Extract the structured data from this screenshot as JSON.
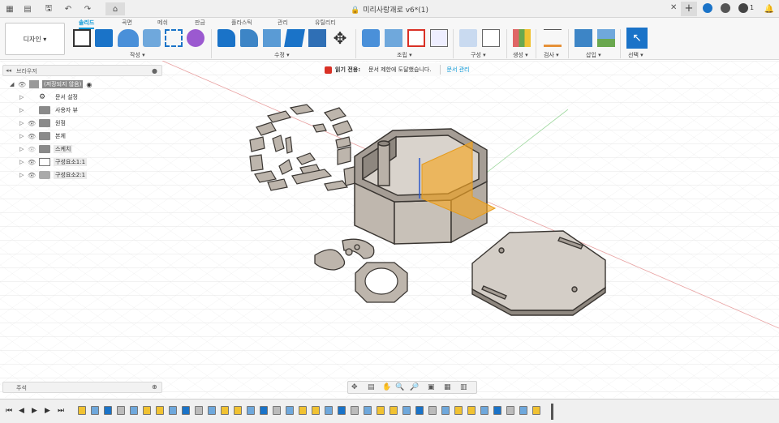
{
  "titlebar": {
    "title": "미리사랑괘로 v6*(1)",
    "notification_count": "1"
  },
  "ribbon": {
    "workspace": "디자인 ▾",
    "tabs": [
      "솔리드",
      "곡면",
      "메쉬",
      "판금",
      "플라스틱",
      "관리",
      "유틸리티"
    ],
    "active_tab": "솔리드",
    "groups": [
      "작성 ▾",
      "수정 ▾",
      "조립 ▾",
      "구성 ▾",
      "검사 ▾",
      "생성 ▾",
      "삽입 ▾",
      "선택 ▾"
    ]
  },
  "browser": {
    "title": "브라우저",
    "items": [
      {
        "label": "(저장되지 않음)"
      },
      {
        "label": "문서 설정"
      },
      {
        "label": "사용자 뷰"
      },
      {
        "label": "원점"
      },
      {
        "label": "본체"
      },
      {
        "label": "스케치"
      },
      {
        "label": "구성요소1:1"
      },
      {
        "label": "구성요소2:1"
      }
    ]
  },
  "banner": {
    "mode": "읽기 전용:",
    "message": "문서 제한에 도달했습니다.",
    "link": "문서 관리"
  },
  "comments": {
    "title": "주석"
  },
  "colors": {
    "accent": "#0696d7",
    "part_fill": "#bdb5ac",
    "part_edge": "#3a3632",
    "construction_plane": "#f5a623"
  }
}
